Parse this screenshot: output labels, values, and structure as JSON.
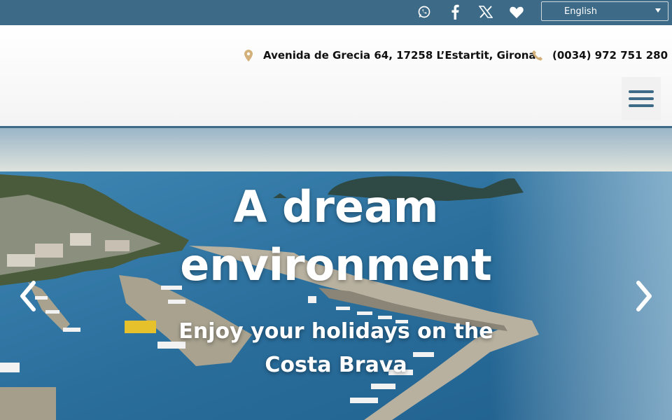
{
  "topbar": {
    "social": [
      {
        "name": "whatsapp-icon"
      },
      {
        "name": "facebook-icon"
      },
      {
        "name": "x-twitter-icon"
      },
      {
        "name": "heart-icon"
      }
    ],
    "language": {
      "selected": "English"
    }
  },
  "header": {
    "address": "Avenida de Grecia 64, 17258 L’Estartit, Girona",
    "phone": "(0034) 972 751 280",
    "icon_color": "#d4b07a",
    "accent": "#3d6a87"
  },
  "hero": {
    "title_line1": "A dream",
    "title_line2": "environment",
    "subtitle_line1": "Enjoy your holidays on the",
    "subtitle_line2": "Costa Brava"
  },
  "colors": {
    "topbar": "#3d6a87",
    "sea": "#2b6f9c",
    "sky": "#cfe0e8"
  }
}
